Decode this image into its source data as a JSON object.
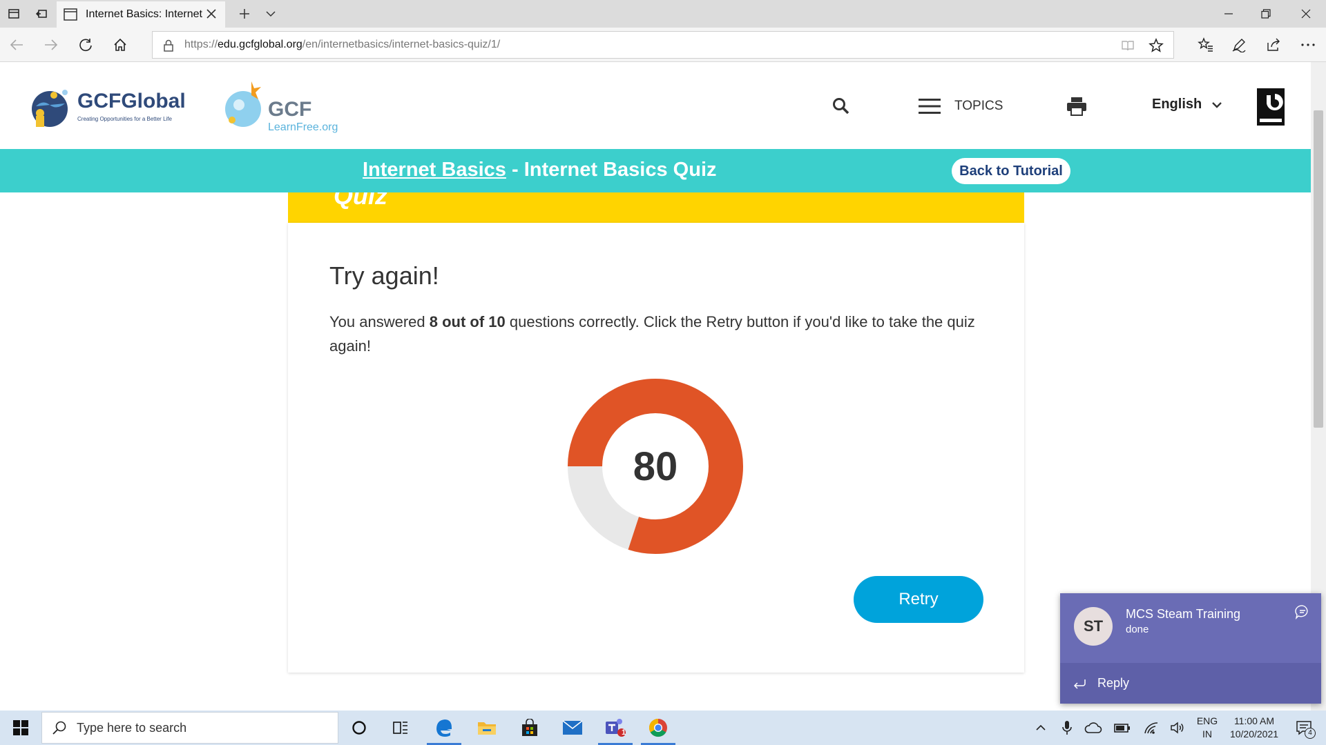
{
  "browser": {
    "tab_title": "Internet Basics: Internet",
    "url_scheme": "https://",
    "url_host": "edu.gcfglobal.org",
    "url_path": "/en/internetbasics/internet-basics-quiz/1/"
  },
  "header": {
    "logo_primary": "GCFGlobal",
    "logo_tagline": "Creating Opportunities for a Better Life",
    "logo_secondary": "GCF",
    "logo_secondary_sub": "LearnFree.org",
    "topics_label": "TOPICS",
    "language": "English"
  },
  "banner": {
    "breadcrumb_link": "Internet Basics",
    "separator": " - ",
    "page_title": "Internet Basics Quiz",
    "back_button": "Back to Tutorial"
  },
  "quiz": {
    "strip_title": "Quiz",
    "result_title": "Try again!",
    "msg_prefix": "You answered ",
    "msg_score": "8 out of 10",
    "msg_suffix": " questions correctly. Click the Retry button if you'd like to take the quiz again!",
    "score": "80",
    "score_percent": 80,
    "retry_button": "Retry",
    "colors": {
      "correct": "#e05426",
      "remaining": "#e8e8e8",
      "retry": "#00a3db",
      "banner": "#3ccfcc",
      "strip": "#ffd400"
    }
  },
  "toast": {
    "avatar_initials": "ST",
    "title": "MCS Steam Training",
    "body": "done",
    "reply": "Reply"
  },
  "taskbar": {
    "search_placeholder": "Type here to search",
    "teams_badge": "1",
    "lang_line1": "ENG",
    "lang_line2": "IN",
    "time": "11:00 AM",
    "date": "10/20/2021",
    "notification_count": "4"
  }
}
